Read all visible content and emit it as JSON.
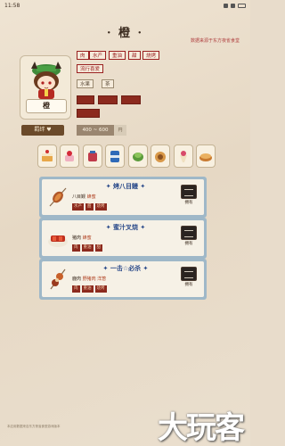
{
  "statusbar": {
    "time": "11:58"
  },
  "header": {
    "title": "· 橙 ·",
    "top_right_link": "数据来源于东方夜雀食堂"
  },
  "character": {
    "name": "橙",
    "preference_tags": [
      "肉",
      "水产",
      "重油",
      "甜",
      "烧烤"
    ],
    "style_tags": [
      "流行喜爱"
    ],
    "drink_tags": [
      "水果",
      "茶"
    ],
    "dislike_tags": [
      "",
      "",
      "",
      ""
    ],
    "bond_label": "羁绊",
    "price_range": "400 ~ 600",
    "price_unit": "円"
  },
  "gifts": [
    {
      "name": "gift-1"
    },
    {
      "name": "gift-2"
    },
    {
      "name": "gift-3"
    },
    {
      "name": "gift-4"
    },
    {
      "name": "gift-5"
    },
    {
      "name": "gift-6"
    },
    {
      "name": "gift-7"
    },
    {
      "name": "gift-8"
    }
  ],
  "dishes": [
    {
      "name": "✦ 烤八目鳗 ✦",
      "desc_prefix": "八目鳗 ",
      "desc_highlight": "蜂蜜",
      "tags": [
        "水产",
        "甜",
        "烧烤"
      ],
      "own_label": "拥有"
    },
    {
      "name": "✦ 蜜汁叉烧 ✦",
      "desc_prefix": "猪肉 ",
      "desc_highlight": "蜂蜜",
      "tags": [
        "肉",
        "重油",
        "甜"
      ],
      "own_label": "拥有"
    },
    {
      "name": "✦ 一击☆必杀 ✦",
      "desc_prefix": "鹿肉 ",
      "desc_highlight": "野猪肉 洋葱",
      "tags": [
        "肉",
        "重油",
        "烧烤"
      ],
      "own_label": "拥有"
    }
  ],
  "footer": {
    "note": "本应用数据来自东方夜雀食堂游戏版本"
  },
  "watermark": "大玩客",
  "colors": {
    "accent_red": "#8c2a1e",
    "dish_frame": "#9fb8c8",
    "dish_title": "#2a4a8a",
    "paper": "#e8dccb"
  }
}
